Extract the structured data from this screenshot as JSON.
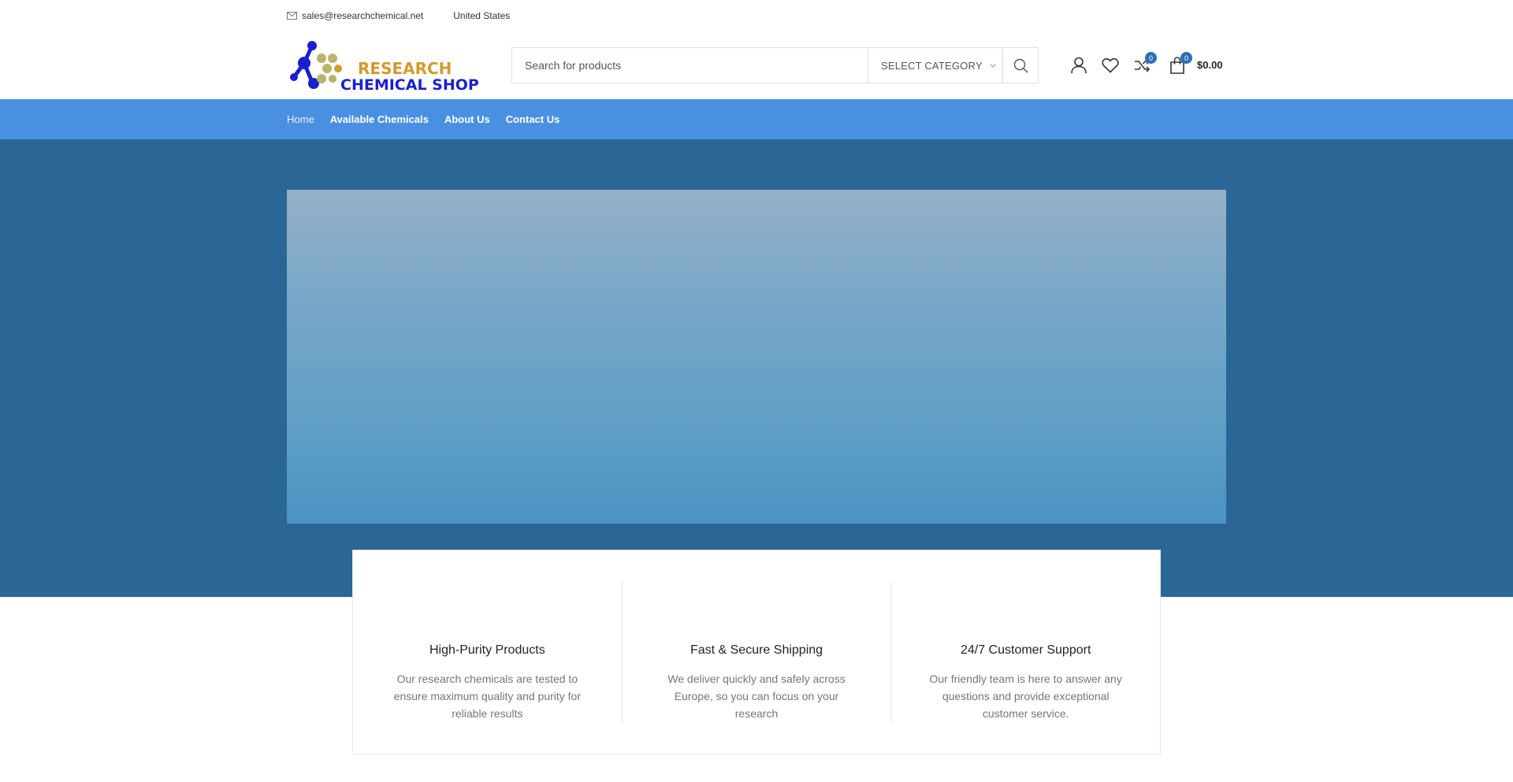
{
  "topbar": {
    "email": "sales@researchchemical.net",
    "country": "United States"
  },
  "logo": {
    "line1": "RESEARCH",
    "line2": "CHEMICAL SHOP",
    "line1_color": "#d49a2c",
    "line2_color": "#1a1fd0"
  },
  "search": {
    "placeholder": "Search for products",
    "category_label": "SELECT CATEGORY"
  },
  "header_icons": {
    "compare_count": "0",
    "cart_count": "0",
    "cart_total": "$0.00"
  },
  "nav": {
    "items": [
      {
        "label": "Home"
      },
      {
        "label": "Available Chemicals"
      },
      {
        "label": "About Us"
      },
      {
        "label": "Contact Us"
      }
    ]
  },
  "features": [
    {
      "title": "High-Purity Products",
      "text": "Our research chemicals are tested to ensure maximum quality and purity for reliable results"
    },
    {
      "title": "Fast & Secure Shipping",
      "text": "We deliver quickly and safely across Europe, so you can focus on your research"
    },
    {
      "title": "24/7 Customer Support",
      "text": "Our friendly team is here to answer any questions and provide exceptional customer service."
    }
  ],
  "colors": {
    "nav_bg": "#4a90e2",
    "hero_bg": "#2a6796",
    "badge": "#2a6fb8"
  },
  "icons": [
    "mail-icon",
    "chevron-down-icon",
    "search-icon",
    "user-icon",
    "heart-icon",
    "compare-icon",
    "cart-icon"
  ]
}
